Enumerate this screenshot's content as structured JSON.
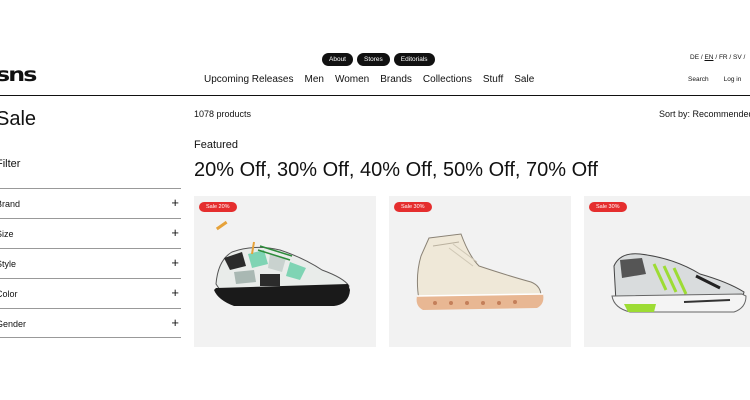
{
  "header": {
    "logo": "sns",
    "pills": [
      "About",
      "Stores",
      "Editorials"
    ],
    "nav": [
      "Upcoming Releases",
      "Men",
      "Women",
      "Brands",
      "Collections",
      "Stuff",
      "Sale"
    ],
    "lang": {
      "de": "DE",
      "en": "EN",
      "fr": "FR",
      "sv": "SV",
      "sep": "/"
    },
    "search_label": "Search",
    "login_label": "Log in"
  },
  "sidebar": {
    "title": "Sale",
    "filter_title": "Filter",
    "filters": [
      "Brand",
      "Size",
      "Style",
      "Color",
      "Gender"
    ]
  },
  "main": {
    "product_count": "1078 products",
    "sort_label": "Sort by: Recommended",
    "featured_label": "Featured",
    "headline": "20% Off, 30% Off, 40% Off, 50% Off, 70% Off",
    "products": [
      {
        "badge": "Sale 20%",
        "icon": "low-top-sneaker-camo"
      },
      {
        "badge": "Sale 30%",
        "icon": "high-top-sneaker-cream"
      },
      {
        "badge": "Sale 30%",
        "icon": "running-sneaker-green"
      }
    ]
  },
  "colors": {
    "badge": "#e52e2e",
    "text": "#111111",
    "card_bg": "#f2f2f2"
  }
}
